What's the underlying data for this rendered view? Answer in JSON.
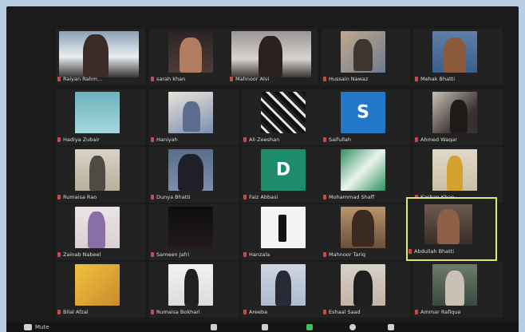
{
  "window_title": "",
  "participants": [
    {
      "name": "Raiyan Rahm..."
    },
    {
      "name": "sarah khan"
    },
    {
      "name": "Mahnoor Alvi"
    },
    {
      "name": "Hussain Nawaz"
    },
    {
      "name": "Mehak Bhatti"
    },
    {
      "name": "Hadiya Zubair"
    },
    {
      "name": "Haniyah"
    },
    {
      "name": "Ali Zeeshan"
    },
    {
      "name": "Saifullah"
    },
    {
      "name": "Ahmed Waqar"
    },
    {
      "name": "Rumaisa Rao"
    },
    {
      "name": "Dunya Bhatti"
    },
    {
      "name": "Faiz Abbasi"
    },
    {
      "name": "Mohammad Shaff"
    },
    {
      "name": "Kashan Khan"
    },
    {
      "name": "Zainab Nabeel"
    },
    {
      "name": "Sameen Jafri"
    },
    {
      "name": "Hanzala"
    },
    {
      "name": "Mahnoor Tariq"
    },
    {
      "name": "Abdullah Bhatti"
    },
    {
      "name": "Bilal Afzal"
    },
    {
      "name": "Rumaisa Bokhari"
    },
    {
      "name": "Areeba"
    },
    {
      "name": "Eshaal Saad"
    },
    {
      "name": "Ammar Rafique"
    }
  ],
  "avatar_letters": {
    "saifullah": "S",
    "faiz": "D"
  },
  "colors": {
    "app_bg": "#b6cde3",
    "window_bg": "#1b1b1b",
    "active_speaker_border": "#e2e675",
    "muted_mic": "#c94a4a",
    "toolbar_accent": "#3fbf5a",
    "saifullah_tile": "#2377c8",
    "faiz_tile": "#1d8c6b"
  },
  "toolbar": {
    "mute_label": "Mute",
    "items": [
      "participants-icon",
      "share-screen-icon",
      "chat-icon",
      "record-icon",
      "reactions-icon",
      "end-meeting-icon"
    ]
  }
}
